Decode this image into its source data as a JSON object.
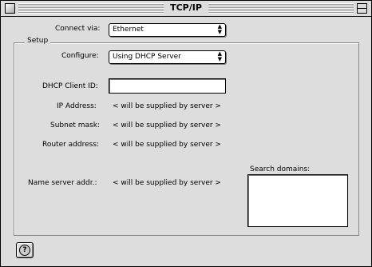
{
  "window": {
    "title": "TCP/IP"
  },
  "connect": {
    "label": "Connect via:",
    "value": "Ethernet"
  },
  "setup": {
    "group_label": "Setup",
    "configure_label": "Configure:",
    "configure_value": "Using DHCP Server",
    "dhcp_client_id_label": "DHCP Client ID:",
    "dhcp_client_id_value": "",
    "ip_label": "IP Address:",
    "ip_value": "< will be supplied by server >",
    "subnet_label": "Subnet mask:",
    "subnet_value": "< will be supplied by server >",
    "router_label": "Router address:",
    "router_value": "< will be supplied by server >",
    "nameserver_label": "Name server addr.:",
    "nameserver_value": "< will be supplied by server >",
    "search_domains_label": "Search domains:",
    "search_domains_value": ""
  },
  "help": {
    "glyph": "?",
    "icon": "help-icon"
  },
  "icons": {
    "popup_arrows": "▲▼"
  }
}
